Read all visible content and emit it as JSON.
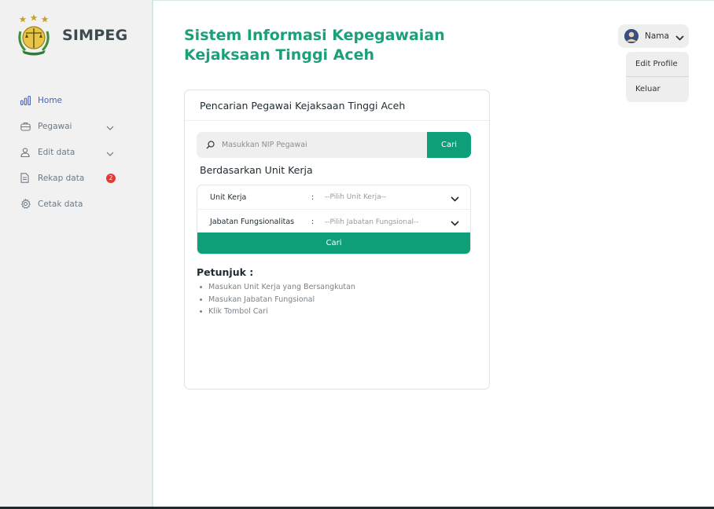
{
  "app": {
    "name": "SIMPEG"
  },
  "colors": {
    "brand": "#0e9f78",
    "title": "#1ba07a",
    "active_nav": "#4464b8",
    "badge": "#e53935"
  },
  "sidebar": {
    "items": [
      {
        "label": "Home",
        "icon": "bar-chart-icon",
        "active": true
      },
      {
        "label": "Pegawai",
        "icon": "briefcase-icon",
        "has_submenu": true
      },
      {
        "label": "Edit data",
        "icon": "user-icon",
        "has_submenu": true
      },
      {
        "label": "Rekap data",
        "icon": "document-icon",
        "badge": "2"
      },
      {
        "label": "Cetak data",
        "icon": "gear-icon"
      }
    ]
  },
  "header": {
    "title_line1": "Sistem Informasi Kepegawaian",
    "title_line2": "Kejaksaan Tinggi Aceh",
    "user_name": "Nama",
    "menu": [
      "Edit Profile",
      "Keluar"
    ]
  },
  "card": {
    "title": "Pencarian Pegawai Kejaksaan Tinggi Aceh",
    "search": {
      "placeholder": "Masukkan NIP Pegawai",
      "value": "",
      "button": "Cari"
    },
    "filter_title": "Berdasarkan Unit Kerja",
    "filters": [
      {
        "label": "Unit Kerja",
        "colon": ":",
        "value": "--Pilih Unit Kerja--"
      },
      {
        "label": "Jabatan Fungsionalitas",
        "colon": ":",
        "value": "--Pilih Jabatan Fungsional--"
      }
    ],
    "filter_button": "Cari",
    "hint_title": "Petunjuk :",
    "hints": [
      "Masukan Unit Kerja yang Bersangkutan",
      "Masukan Jabatan Fungsional",
      "Klik Tombol Cari"
    ]
  }
}
